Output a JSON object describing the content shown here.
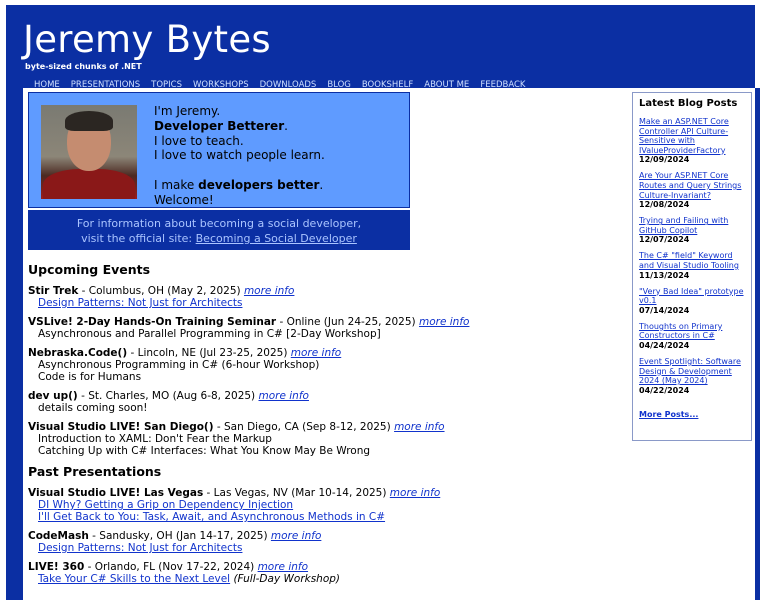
{
  "header": {
    "title": "Jeremy Bytes",
    "tagline": "byte-sized chunks of .NET",
    "nav": [
      "HOME",
      "PRESENTATIONS",
      "TOPICS",
      "WORKSHOPS",
      "DOWNLOADS",
      "BLOG",
      "BOOKSHELF",
      "ABOUT ME",
      "FEEDBACK"
    ]
  },
  "intro": {
    "line1": "I'm Jeremy.",
    "line2": "Developer Betterer",
    "line2_end": ".",
    "line3": "I love to teach.",
    "line4": "I love to watch people learn.",
    "line5_start": "I make ",
    "line5_bold": "developers better",
    "line5_end": ".",
    "line6": "Welcome!"
  },
  "social": {
    "line1": "For information about becoming a social developer,",
    "line2_start": "visit the official site: ",
    "link": "Becoming a Social Developer"
  },
  "upcoming": {
    "heading": "Upcoming Events",
    "events": [
      {
        "name": "Stir Trek",
        "detail": " - Columbus, OH (May 2, 2025) ",
        "more": "more info",
        "items": [
          {
            "text": "Design Patterns: Not Just for Architects",
            "link": true
          }
        ]
      },
      {
        "name": "VSLive! 2-Day Hands-On Training Seminar",
        "detail": " - Online (Jun 24-25, 2025) ",
        "more": "more info",
        "items": [
          {
            "text": "Asynchronous and Parallel Programming in C# [2-Day Workshop]",
            "link": false
          }
        ]
      },
      {
        "name": "Nebraska.Code()",
        "detail": " - Lincoln, NE (Jul 23-25, 2025) ",
        "more": "more info",
        "items": [
          {
            "text": "Asynchronous Programming in C# (6-hour Workshop)",
            "link": false
          },
          {
            "text": "Code is for Humans",
            "link": false
          }
        ]
      },
      {
        "name": "dev up()",
        "detail": " - St. Charles, MO (Aug 6-8, 2025) ",
        "more": "more info",
        "items": [
          {
            "text": "details coming soon!",
            "link": false
          }
        ]
      },
      {
        "name": "Visual Studio LIVE! San Diego()",
        "detail": " - San Diego, CA (Sep 8-12, 2025) ",
        "more": "more info",
        "items": [
          {
            "text": "Introduction to XAML: Don't Fear the Markup",
            "link": false
          },
          {
            "text": "Catching Up with C# Interfaces: What You Know May Be Wrong",
            "link": false
          }
        ]
      }
    ]
  },
  "past": {
    "heading": "Past Presentations",
    "events": [
      {
        "name": "Visual Studio LIVE! Las Vegas",
        "detail": " - Las Vegas, NV (Mar 10-14, 2025) ",
        "more": "more info",
        "items": [
          {
            "text": "DI Why? Getting a Grip on Dependency Injection",
            "link": true
          },
          {
            "text": "I'll Get Back to You: Task, Await, and Asynchronous Methods in C#",
            "link": true
          }
        ]
      },
      {
        "name": "CodeMash",
        "detail": " - Sandusky, OH (Jan 14-17, 2025) ",
        "more": "more info",
        "items": [
          {
            "text": "Design Patterns: Not Just for Architects",
            "link": true
          }
        ]
      },
      {
        "name": "LIVE! 360",
        "detail": " - Orlando, FL (Nov 17-22, 2024) ",
        "more": "more info",
        "items": [
          {
            "text": "Take Your C# Skills to the Next Level",
            "link": true,
            "suffix": " (Full-Day Workshop)"
          }
        ]
      }
    ]
  },
  "blog": {
    "heading": "Latest Blog Posts",
    "posts": [
      {
        "title": "Make an ASP.NET Core Controller API Culture-Sensitive with IValueProviderFactory",
        "date": "12/09/2024"
      },
      {
        "title": "Are Your ASP.NET Core Routes and Query Strings Culture-Invariant?",
        "date": "12/08/2024"
      },
      {
        "title": "Trying and Failing with GitHub Copilot",
        "date": "12/07/2024"
      },
      {
        "title": "The C# \"field\" Keyword and Visual Studio Tooling",
        "date": "11/13/2024"
      },
      {
        "title": "\"Very Bad Idea\" prototype v0.1",
        "date": "07/14/2024"
      },
      {
        "title": "Thoughts on Primary Constructors in C#",
        "date": "04/24/2024"
      },
      {
        "title": "Event Spotlight: Software Design & Development 2024 (May 2024)",
        "date": "04/22/2024"
      }
    ],
    "more": "More Posts..."
  }
}
